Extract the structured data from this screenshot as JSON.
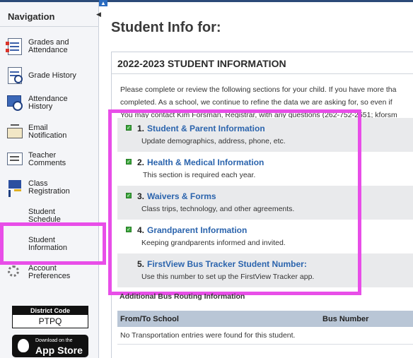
{
  "sidebar": {
    "heading": "Navigation",
    "items": [
      {
        "label_line1": "Grades and",
        "label_line2": "Attendance",
        "icon": "grades-icon"
      },
      {
        "label_line1": "Grade History",
        "label_line2": "",
        "icon": "grade-history-icon"
      },
      {
        "label_line1": "Attendance",
        "label_line2": "History",
        "icon": "attendance-history-icon"
      },
      {
        "label_line1": "Email",
        "label_line2": "Notification",
        "icon": "email-icon"
      },
      {
        "label_line1": "Teacher",
        "label_line2": "Comments",
        "icon": "comments-icon"
      },
      {
        "label_line1": "Class",
        "label_line2": "Registration",
        "icon": "registration-icon"
      },
      {
        "label_line1": "Student",
        "label_line2": "Schedule",
        "icon": ""
      },
      {
        "label_line1": "Student",
        "label_line2": "Information",
        "icon": ""
      },
      {
        "label_line1": "Account",
        "label_line2": "Preferences",
        "icon": "gear-icon"
      }
    ],
    "district_code_label": "District Code",
    "district_code_value": "PTPQ",
    "appstore_small": "Download on the",
    "appstore_big": "App Store"
  },
  "main": {
    "title": "Student Info for:",
    "panel_title": "2022-2023 STUDENT INFORMATION",
    "intro_lines": [
      "Please complete or review the following sections for your child. If you have more tha",
      "completed. As a school, we continue to refine the data we are asking for, so even if",
      "You may contact Kim Forsman, Registrar, with any questions (262-752-2551; kforsm"
    ],
    "sections": [
      {
        "num": "1.",
        "title": "Student & Parent Information",
        "desc": "Update demographics, address, phone, etc.",
        "checked": true
      },
      {
        "num": "2.",
        "title": "Health & Medical Information",
        "desc": "This section is required each year.",
        "checked": true
      },
      {
        "num": "3.",
        "title": "Waivers & Forms",
        "desc": "Class trips, technology, and other agreements.",
        "checked": true
      },
      {
        "num": "4.",
        "title": "Grandparent Information",
        "desc": "Keeping grandparents informed and invited.",
        "checked": true
      },
      {
        "num": "5.",
        "title": "FirstView Bus Tracker Student Number:",
        "desc": "Use this number to set up the FirstView Tracker app.",
        "checked": false
      }
    ],
    "bus_heading": "Additional Bus Routing Information",
    "bus_columns": [
      "From/To School",
      "Bus Number"
    ],
    "bus_empty": "No Transportation entries were found for this student."
  },
  "colors": {
    "highlight": "#e84ee8",
    "link": "#2b64ad",
    "table_header": "#b9c6d6"
  }
}
